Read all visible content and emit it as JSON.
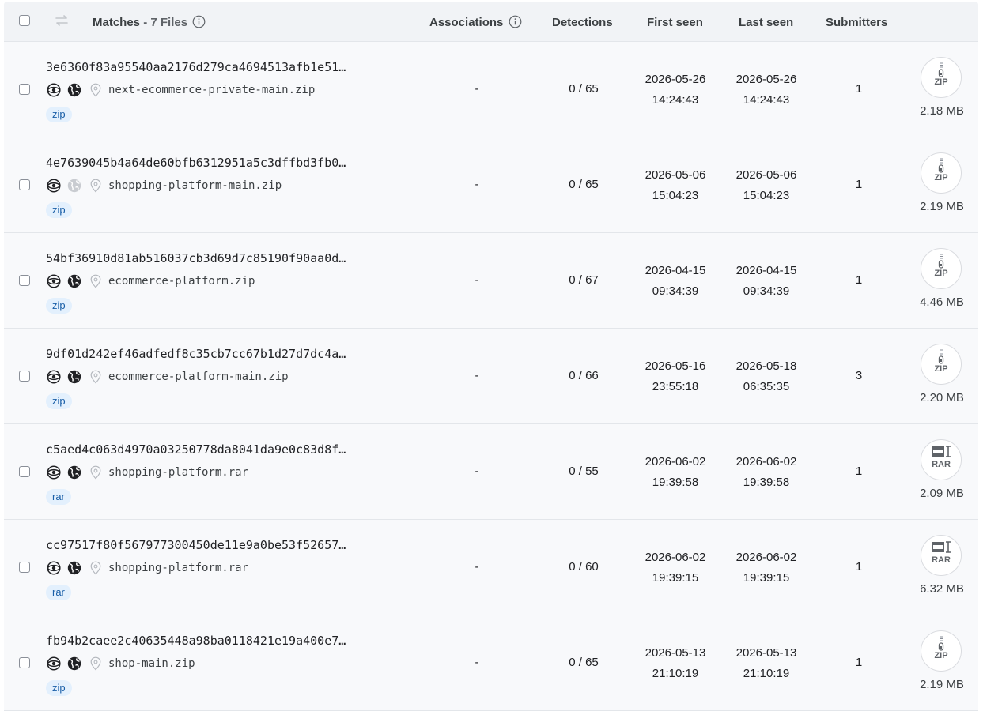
{
  "header": {
    "matches_label": "Matches",
    "files_count": "7 Files",
    "associations": "Associations",
    "detections": "Detections",
    "first_seen": "First seen",
    "last_seen": "Last seen",
    "submitters": "Submitters"
  },
  "colors": {
    "tag_bg": "#e3f0fd",
    "tag_text": "#1a5fa8",
    "row_bg": "#f8f9fb",
    "header_bg": "#f1f3f6"
  },
  "rows": [
    {
      "hash": "3e6360f83a95540aa2176d279ca4694513afb1e51…",
      "filename": "next-ecommerce-private-main.zip",
      "tag": "zip",
      "associations": "-",
      "detections": "0 / 65",
      "first_date": "2026-05-26",
      "first_time": "14:24:43",
      "last_date": "2026-05-26",
      "last_time": "14:24:43",
      "submitters": "1",
      "type_label": "ZIP",
      "size": "2.18 MB",
      "globe_active": true
    },
    {
      "hash": "4e7639045b4a64de60bfb6312951a5c3dffbd3fb0…",
      "filename": "shopping-platform-main.zip",
      "tag": "zip",
      "associations": "-",
      "detections": "0 / 65",
      "first_date": "2026-05-06",
      "first_time": "15:04:23",
      "last_date": "2026-05-06",
      "last_time": "15:04:23",
      "submitters": "1",
      "type_label": "ZIP",
      "size": "2.19 MB",
      "globe_active": false
    },
    {
      "hash": "54bf36910d81ab516037cb3d69d7c85190f90aa0d…",
      "filename": "ecommerce-platform.zip",
      "tag": "zip",
      "associations": "-",
      "detections": "0 / 67",
      "first_date": "2026-04-15",
      "first_time": "09:34:39",
      "last_date": "2026-04-15",
      "last_time": "09:34:39",
      "submitters": "1",
      "type_label": "ZIP",
      "size": "4.46 MB",
      "globe_active": true
    },
    {
      "hash": "9df01d242ef46adfedf8c35cb7cc67b1d27d7dc4a…",
      "filename": "ecommerce-platform-main.zip",
      "tag": "zip",
      "associations": "-",
      "detections": "0 / 66",
      "first_date": "2026-05-16",
      "first_time": "23:55:18",
      "last_date": "2026-05-18",
      "last_time": "06:35:35",
      "submitters": "3",
      "type_label": "ZIP",
      "size": "2.20 MB",
      "globe_active": true
    },
    {
      "hash": "c5aed4c063d4970a03250778da8041da9e0c83d8f…",
      "filename": "shopping-platform.rar",
      "tag": "rar",
      "associations": "-",
      "detections": "0 / 55",
      "first_date": "2026-06-02",
      "first_time": "19:39:58",
      "last_date": "2026-06-02",
      "last_time": "19:39:58",
      "submitters": "1",
      "type_label": "RAR",
      "size": "2.09 MB",
      "globe_active": true
    },
    {
      "hash": "cc97517f80f567977300450de11e9a0be53f52657…",
      "filename": "shopping-platform.rar",
      "tag": "rar",
      "associations": "-",
      "detections": "0 / 60",
      "first_date": "2026-06-02",
      "first_time": "19:39:15",
      "last_date": "2026-06-02",
      "last_time": "19:39:15",
      "submitters": "1",
      "type_label": "RAR",
      "size": "6.32 MB",
      "globe_active": true
    },
    {
      "hash": "fb94b2caee2c40635448a98ba0118421e19a400e7…",
      "filename": "shop-main.zip",
      "tag": "zip",
      "associations": "-",
      "detections": "0 / 65",
      "first_date": "2026-05-13",
      "first_time": "21:10:19",
      "last_date": "2026-05-13",
      "last_time": "21:10:19",
      "submitters": "1",
      "type_label": "ZIP",
      "size": "2.19 MB",
      "globe_active": true
    }
  ]
}
